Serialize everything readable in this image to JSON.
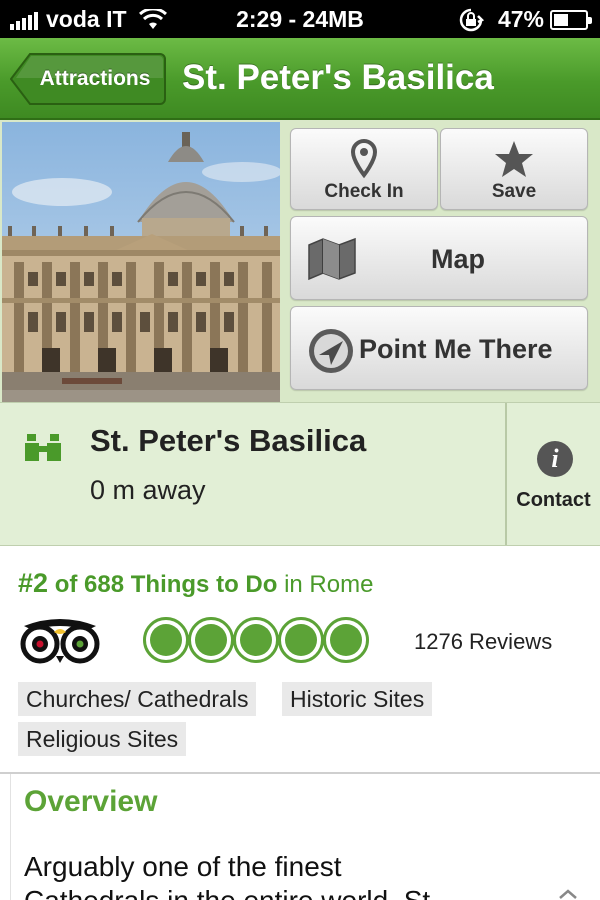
{
  "status_bar": {
    "carrier": "voda IT",
    "time_data": "2:29 - 24MB",
    "battery_pct": "47%",
    "battery_level": 0.47
  },
  "nav": {
    "back_label": "Attractions",
    "title": "St. Peter's Basilica"
  },
  "actions": {
    "check_in": "Check In",
    "save": "Save",
    "map": "Map",
    "point_me_there": "Point Me There"
  },
  "info": {
    "name": "St. Peter's Basilica",
    "distance": "0 m away",
    "contact_label": "Contact",
    "contact_icon": "i"
  },
  "ranking": {
    "rank": "#2",
    "of_text": "of 688 Things to Do",
    "location": "in Rome",
    "rating": 5,
    "rating_max": 5,
    "reviews": "1276 Reviews"
  },
  "tags": [
    "Churches/ Cathedrals",
    "Historic Sites",
    "Religious Sites"
  ],
  "overview": {
    "title": "Overview",
    "text_line1": "Arguably one of the finest",
    "text_line2": "Cathedrals in the entire world, St."
  },
  "colors": {
    "brand_green": "#4a9a2a",
    "bubble_green": "#5ca337",
    "info_bg": "#e2efd6"
  }
}
